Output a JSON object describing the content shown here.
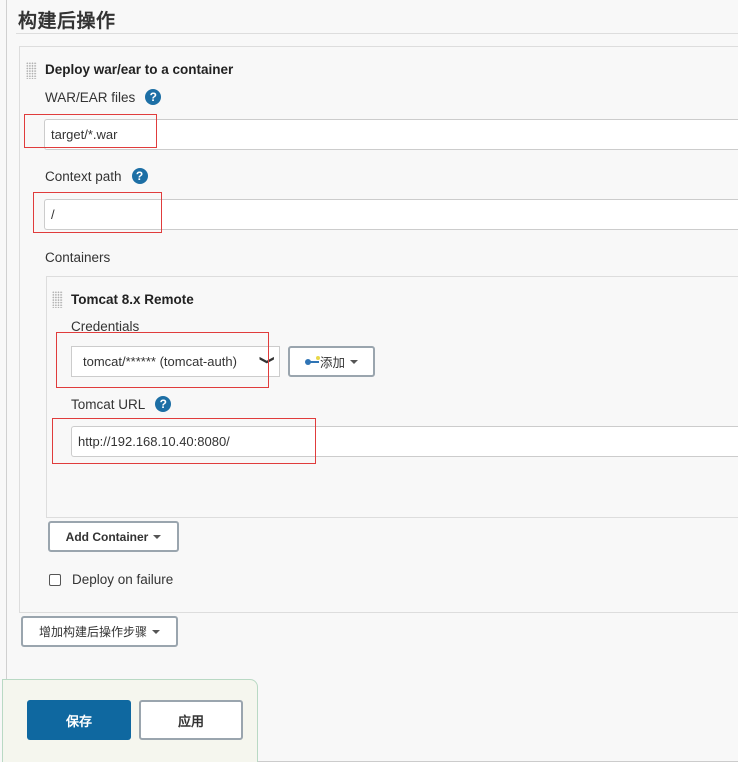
{
  "section": {
    "title": "构建后操作"
  },
  "deploy": {
    "title": "Deploy war/ear to a container",
    "war_files": {
      "label": "WAR/EAR files",
      "value": "target/*.war",
      "help": "?"
    },
    "context_path": {
      "label": "Context path",
      "value": "/",
      "help": "?"
    },
    "containers_label": "Containers",
    "container": {
      "title": "Tomcat 8.x Remote",
      "credentials": {
        "label": "Credentials",
        "selected": "tomcat/****** (tomcat-auth)",
        "chevron": "❯",
        "add_label": "添加"
      },
      "tomcat_url": {
        "label": "Tomcat URL",
        "value": "http://192.168.10.40:8080/",
        "help": "?"
      }
    },
    "add_container_label": "Add Container",
    "deploy_on_failure": {
      "label": "Deploy on failure",
      "checked": false
    }
  },
  "add_post_build_label": "增加构建后操作步骤",
  "actions": {
    "save": "保存",
    "apply": "应用"
  },
  "colors": {
    "primary": "#0f68a0",
    "help": "#1d6fa5",
    "highlight": "#e03c3c"
  }
}
